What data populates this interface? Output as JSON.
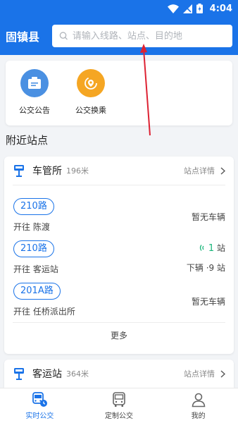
{
  "status_bar": {
    "time": "4:04",
    "icons": [
      "wifi-icon",
      "signal-off-icon",
      "battery-charging-icon"
    ]
  },
  "header": {
    "city": "固镇县",
    "search_placeholder": "请输入线路、站点、目的地"
  },
  "quick_actions": [
    {
      "label": "公交公告",
      "icon": "announcement-icon",
      "color": "#4a90e2"
    },
    {
      "label": "公交换乘",
      "icon": "transfer-icon",
      "color": "#f5a623"
    }
  ],
  "nearby": {
    "title": "附近站点",
    "stations": [
      {
        "name": "车管所",
        "distance": "196米",
        "detail_label": "站点详情",
        "routes": [
          {
            "route": "210路",
            "direction": "开往 陈渡",
            "status": "暂无车辆"
          },
          {
            "route": "210路",
            "direction": "开往 客运站",
            "arrive_count": "1",
            "arrive_unit": "站",
            "next_bus": "下辆 ·9 站"
          },
          {
            "route": "201A路",
            "direction": "开往 任桥派出所",
            "status": "暂无车辆"
          }
        ],
        "more_label": "更多"
      },
      {
        "name": "客运站",
        "distance": "364米",
        "detail_label": "站点详情"
      }
    ]
  },
  "tabbar": [
    {
      "label": "实时公交",
      "icon": "realtime-bus-icon",
      "active": true
    },
    {
      "label": "定制公交",
      "icon": "bus-icon",
      "active": false
    },
    {
      "label": "我的",
      "icon": "user-icon",
      "active": false
    }
  ],
  "colors": {
    "primary": "#1a73e8",
    "arrive_green": "#19b57a"
  }
}
